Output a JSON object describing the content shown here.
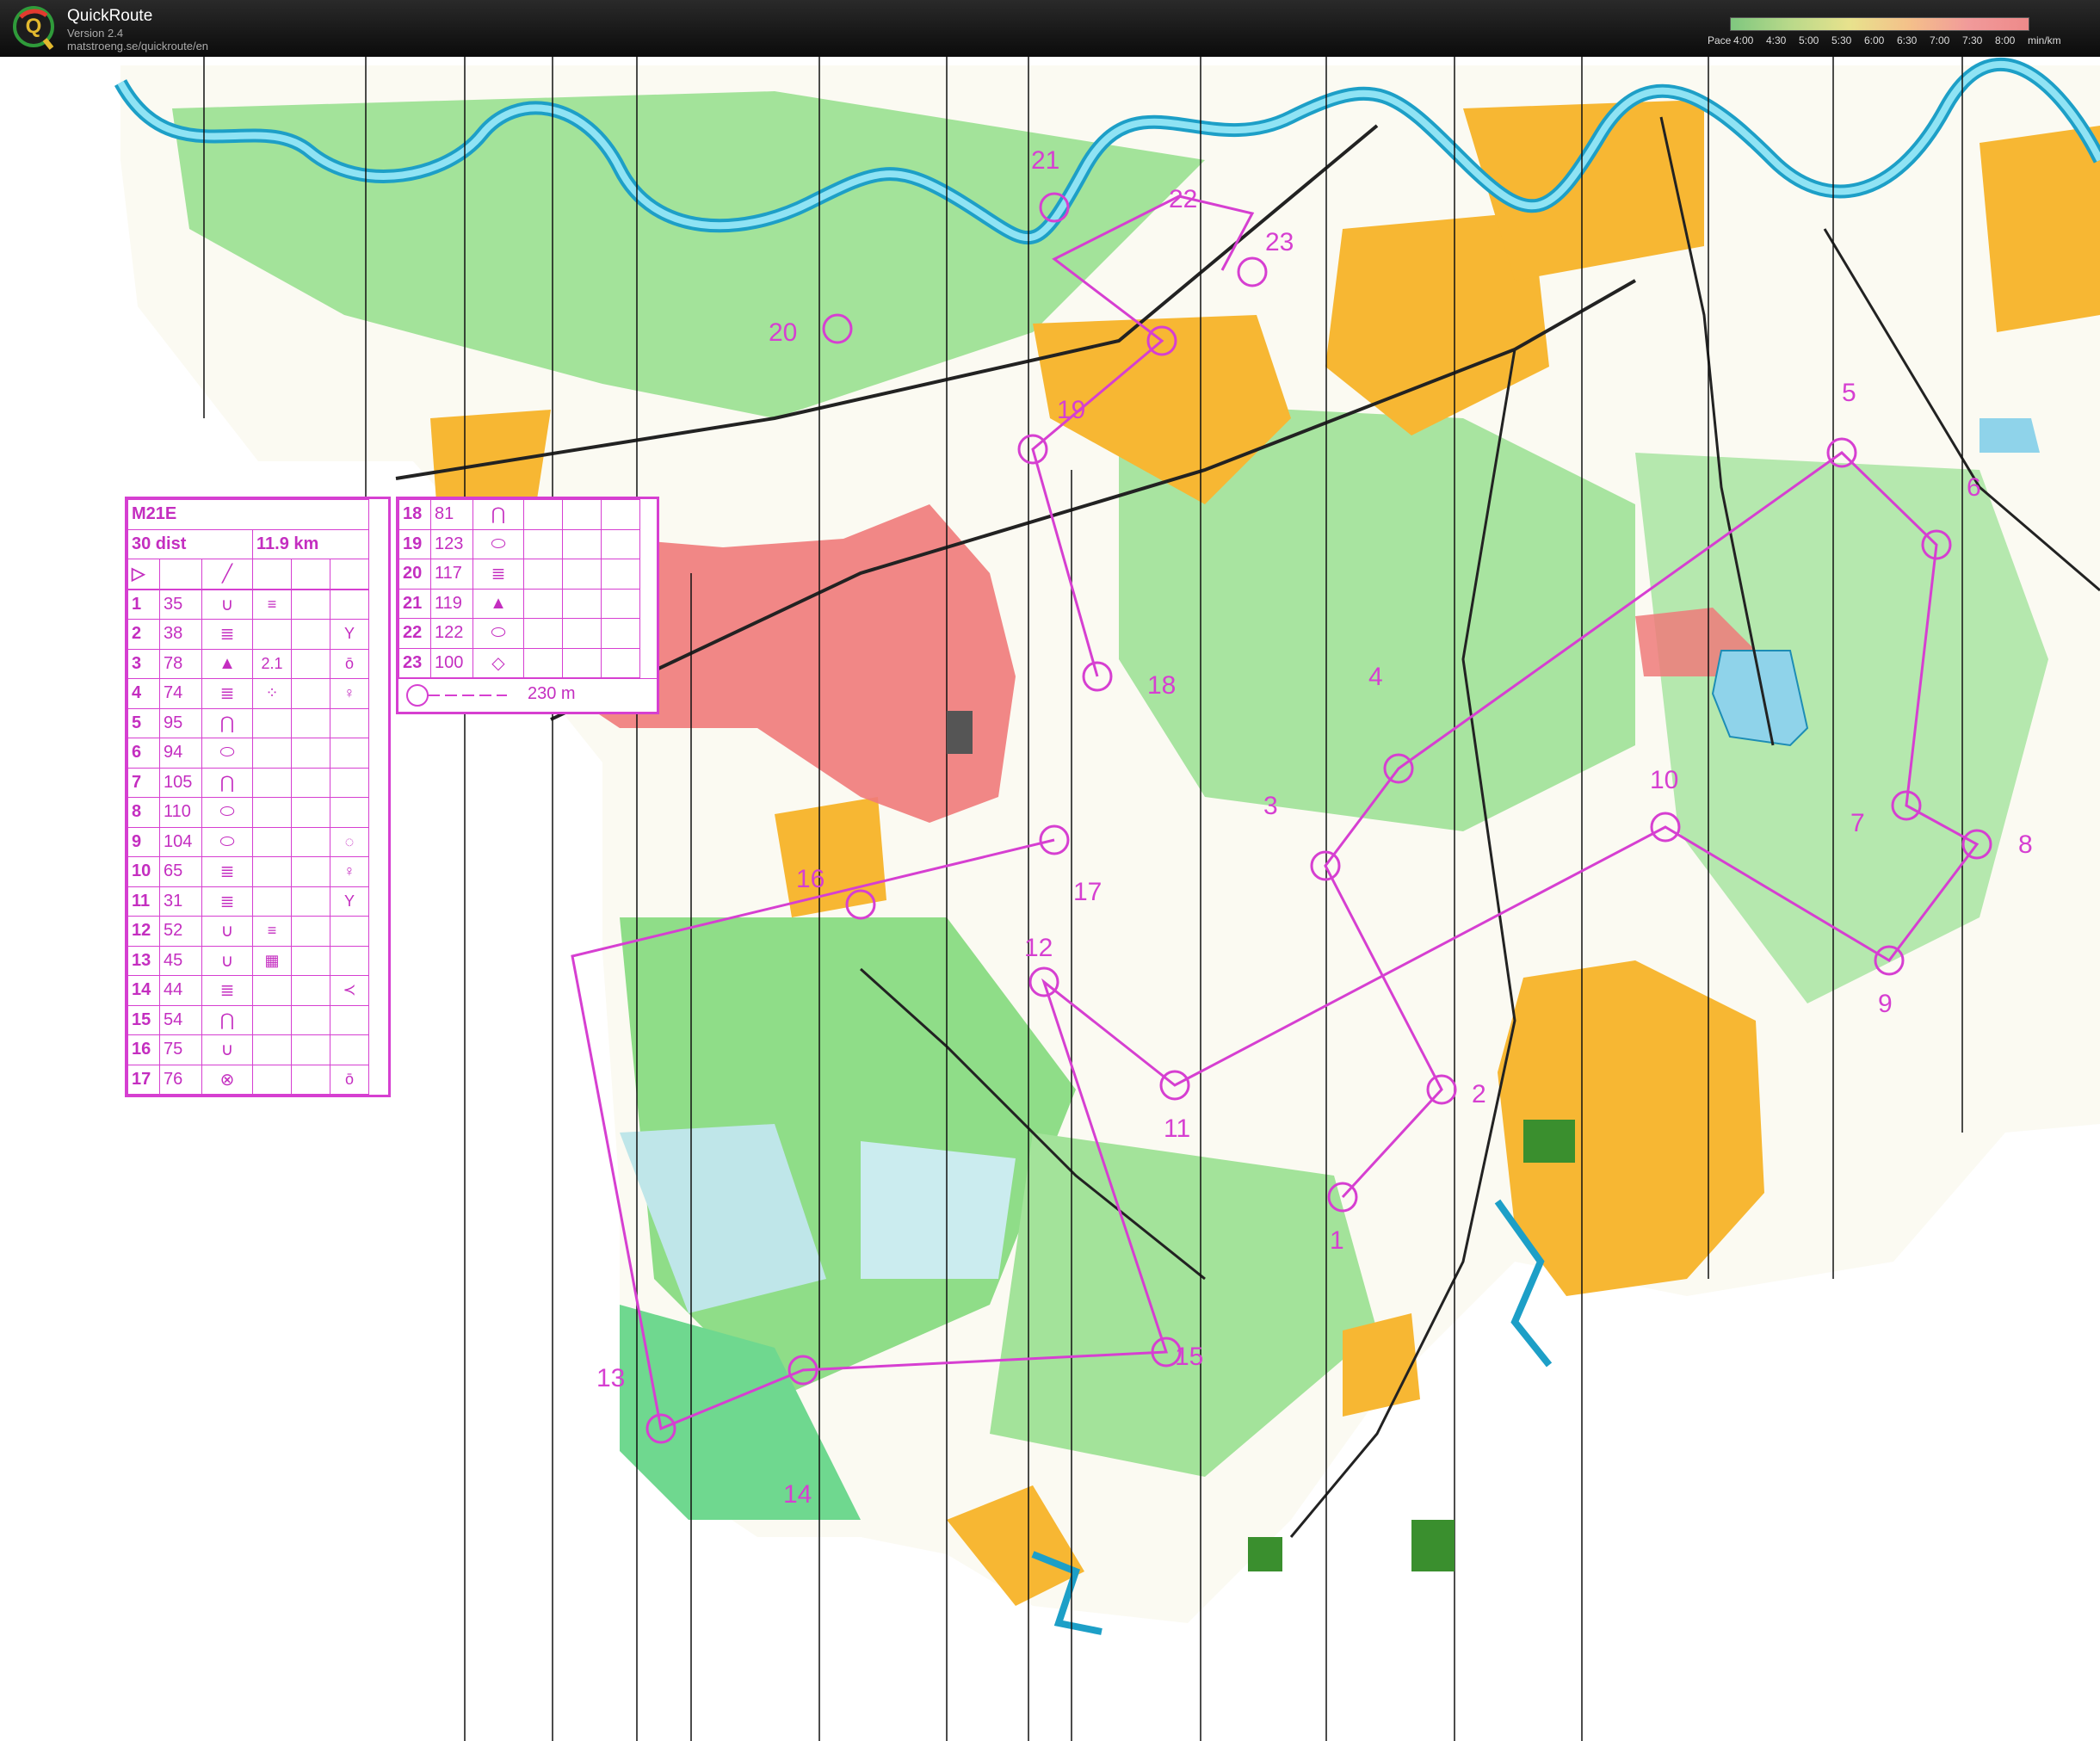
{
  "app": {
    "name": "QuickRoute",
    "version": "Version 2.4",
    "url": "matstroeng.se/quickroute/en"
  },
  "pace_legend": {
    "prefix": "Pace",
    "labels": [
      "4:00",
      "4:30",
      "5:00",
      "5:30",
      "6:00",
      "6:30",
      "7:00",
      "7:30",
      "8:00"
    ],
    "unit": "min/km",
    "colors": [
      "#7fc77f",
      "#b9d98a",
      "#e8e28d",
      "#f4c08a",
      "#f19a9a",
      "#ee8a8a"
    ]
  },
  "course": {
    "class": "M21E",
    "stats": [
      "30 dist",
      "11.9 km"
    ],
    "controls_left": [
      {
        "n": "1",
        "code": "35",
        "sym": "∪",
        "ex": "≡",
        "ex2": ""
      },
      {
        "n": "2",
        "code": "38",
        "sym": "≣",
        "ex": "",
        "ex2": "Y"
      },
      {
        "n": "3",
        "code": "78",
        "sym": "▲",
        "ex": "2.1",
        "ex2": "ō"
      },
      {
        "n": "4",
        "code": "74",
        "sym": "≣",
        "ex": "⁘",
        "ex2": "♀"
      },
      {
        "n": "5",
        "code": "95",
        "sym": "⋂",
        "ex": "",
        "ex2": ""
      },
      {
        "n": "6",
        "code": "94",
        "sym": "⬭",
        "ex": "",
        "ex2": ""
      },
      {
        "n": "7",
        "code": "105",
        "sym": "⋂",
        "ex": "",
        "ex2": ""
      },
      {
        "n": "8",
        "code": "110",
        "sym": "⬭",
        "ex": "",
        "ex2": ""
      },
      {
        "n": "9",
        "code": "104",
        "sym": "⬭",
        "ex": "",
        "ex2": "◌"
      },
      {
        "n": "10",
        "code": "65",
        "sym": "≣",
        "ex": "",
        "ex2": "♀"
      },
      {
        "n": "11",
        "code": "31",
        "sym": "≣",
        "ex": "",
        "ex2": "Y"
      },
      {
        "n": "12",
        "code": "52",
        "sym": "∪",
        "ex": "≡",
        "ex2": ""
      },
      {
        "n": "13",
        "code": "45",
        "sym": "∪",
        "ex": "▦",
        "ex2": ""
      },
      {
        "n": "14",
        "code": "44",
        "sym": "≣",
        "ex": "",
        "ex2": "≺"
      },
      {
        "n": "15",
        "code": "54",
        "sym": "⋂",
        "ex": "",
        "ex2": ""
      },
      {
        "n": "16",
        "code": "75",
        "sym": "∪",
        "ex": "",
        "ex2": ""
      },
      {
        "n": "17",
        "code": "76",
        "sym": "⊗",
        "ex": "",
        "ex2": "ō"
      }
    ],
    "controls_right": [
      {
        "n": "18",
        "code": "81",
        "sym": "⋂"
      },
      {
        "n": "19",
        "code": "123",
        "sym": "⬭"
      },
      {
        "n": "20",
        "code": "117",
        "sym": "≣"
      },
      {
        "n": "21",
        "code": "119",
        "sym": "▲"
      },
      {
        "n": "22",
        "code": "122",
        "sym": "⬭"
      },
      {
        "n": "23",
        "code": "100",
        "sym": "◇"
      }
    ],
    "finish": "230 m",
    "map_labels": [
      "1",
      "2",
      "3",
      "4",
      "5",
      "6",
      "7",
      "8",
      "9",
      "10",
      "11",
      "12",
      "13",
      "14",
      "15",
      "16",
      "17",
      "18",
      "19",
      "20",
      "21",
      "22",
      "23"
    ]
  },
  "colors": {
    "course_magenta": "#d63fd1",
    "forest_green": "#7fd67a",
    "open_yellow": "#f7b733",
    "water_blue": "#4bc3dd",
    "slow_route_red": "#ef6f6f"
  }
}
